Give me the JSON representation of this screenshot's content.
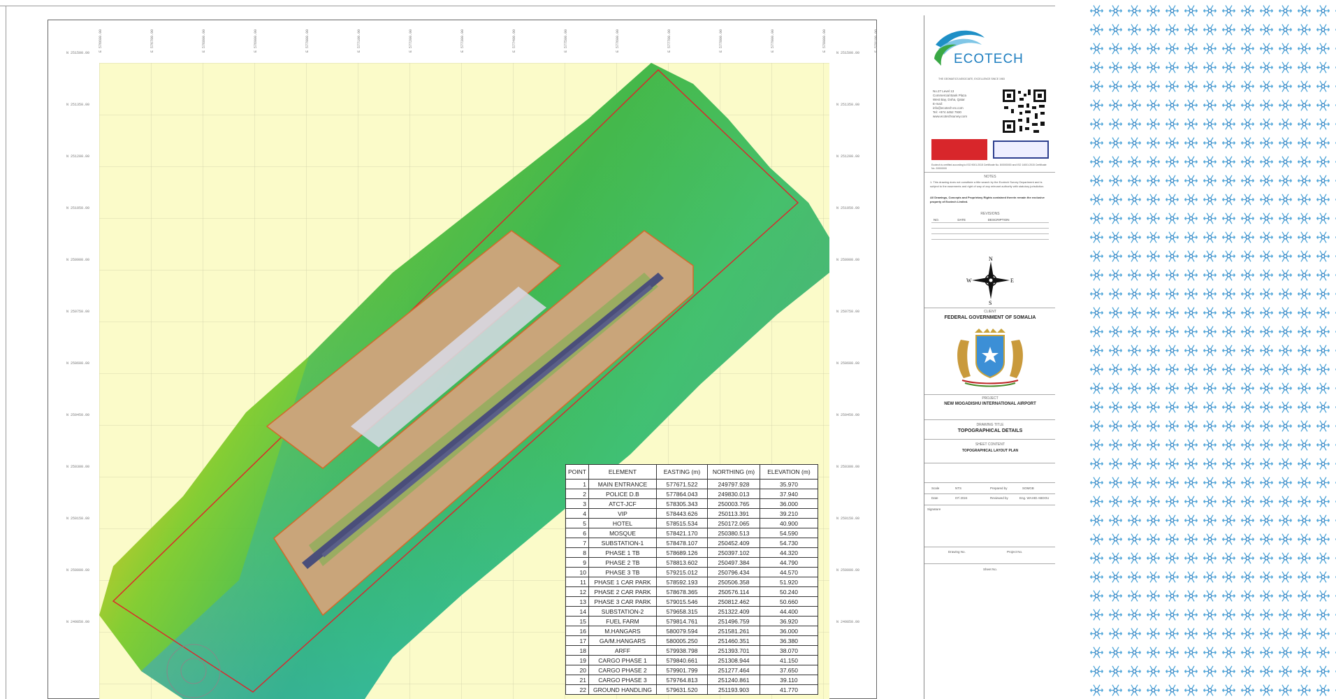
{
  "grid": {
    "eastings": [
      "E 576600.00",
      "E 576700.00",
      "E 576800.00",
      "E 576900.00",
      "E 577000.00",
      "E 577100.00",
      "E 577200.00",
      "E 577300.00",
      "E 577400.00",
      "E 577500.00",
      "E 577600.00",
      "E 577700.00",
      "E 577800.00",
      "E 577900.00",
      "E 578000.00",
      "E 578100.00"
    ],
    "northings_left": [
      "N 251500.00",
      "N 251350.00",
      "N 251200.00",
      "N 251050.00",
      "N 250900.00",
      "N 250750.00",
      "N 250600.00",
      "N 250450.00",
      "N 250300.00",
      "N 250150.00",
      "N 250000.00",
      "N 249850.00"
    ],
    "northings_right": [
      "N 251500.00",
      "N 251350.00",
      "N 251200.00",
      "N 251050.00",
      "N 250900.00",
      "N 250750.00",
      "N 250600.00",
      "N 250450.00",
      "N 250300.00",
      "N 250150.00",
      "N 250000.00",
      "N 249850.00"
    ]
  },
  "table": {
    "headers": [
      "POINT",
      "ELEMENT",
      "EASTING (m)",
      "NORTHING (m)",
      "ELEVATION (m)"
    ],
    "rows": [
      [
        "1",
        "MAIN ENTRANCE",
        "577671.522",
        "249797.928",
        "35.970"
      ],
      [
        "2",
        "POLICE D.B",
        "577864.043",
        "249830.013",
        "37.940"
      ],
      [
        "3",
        "ATCT-JCF",
        "578305.343",
        "250003.765",
        "36.000"
      ],
      [
        "4",
        "VIP",
        "578443.626",
        "250113.391",
        "39.210"
      ],
      [
        "5",
        "HOTEL",
        "578515.534",
        "250172.065",
        "40.900"
      ],
      [
        "6",
        "MOSQUE",
        "578421.170",
        "250380.513",
        "54.590"
      ],
      [
        "7",
        "SUBSTATION-1",
        "578478.107",
        "250452.409",
        "54.730"
      ],
      [
        "8",
        "PHASE 1 TB",
        "578689.126",
        "250397.102",
        "44.320"
      ],
      [
        "9",
        "PHASE 2 TB",
        "578813.602",
        "250497.384",
        "44.790"
      ],
      [
        "10",
        "PHASE 3 TB",
        "579215.012",
        "250796.434",
        "44.570"
      ],
      [
        "11",
        "PHASE 1 CAR PARK",
        "578592.193",
        "250506.358",
        "51.920"
      ],
      [
        "12",
        "PHASE 2 CAR PARK",
        "578678.365",
        "250576.114",
        "50.240"
      ],
      [
        "13",
        "PHASE 3 CAR PARK",
        "579015.546",
        "250812.462",
        "50.660"
      ],
      [
        "14",
        "SUBSTATION-2",
        "579658.315",
        "251322.409",
        "44.400"
      ],
      [
        "15",
        "FUEL FARM",
        "579814.761",
        "251496.759",
        "36.920"
      ],
      [
        "16",
        "M.HANGARS",
        "580079.594",
        "251581.261",
        "36.000"
      ],
      [
        "17",
        "GA/M.HANGARS",
        "580005.250",
        "251460.351",
        "36.380"
      ],
      [
        "18",
        "ARFF",
        "579938.798",
        "251393.701",
        "38.070"
      ],
      [
        "19",
        "CARGO PHASE 1",
        "579840.661",
        "251308.944",
        "41.150"
      ],
      [
        "20",
        "CARGO PHASE 2",
        "579901.799",
        "251277.464",
        "37.650"
      ],
      [
        "21",
        "CARGO PHASE 3",
        "579764.813",
        "251240.861",
        "39.110"
      ],
      [
        "22",
        "GROUND HANDLING",
        "579631.520",
        "251193.903",
        "41.770"
      ]
    ]
  },
  "title_block": {
    "company": "ECOTECH",
    "tagline": "THE GEOMATICS ASSOCIATE, EXCELLENCE SINCE 1983",
    "address_lines": [
      "No.27 Level 13",
      "Commercial Bank Plaza",
      "West Bay, Doha, Qatar",
      "E-mail:",
      "info@ecotech-ex.com",
      "Tel: +974 4452 7930",
      "www.ecotechsurvey.com"
    ],
    "cert_text": "Ecotech is certified according to ISO 9001:2015 Certificate No. 8/0000000 and ISO 14001:2015 Certificate No. 20000000",
    "notes_title": "NOTES",
    "notes_1": "1. This drawing does not constitute a title search by the Ecotech Survey Department and is subject to the easements and right of way of any relevant authority with statutory jurisdiction.",
    "notes_2": "All Drawings, Concepts and Proprietary Rights contained therein remain the exclusive property of Ecotech Limited.",
    "revisions_title": "REVISIONS",
    "rev_headers": [
      "NO.",
      "DATE",
      "DESCRIPTION"
    ],
    "compass": {
      "n": "N",
      "s": "S",
      "e": "E",
      "w": "W"
    },
    "client_label": "CLIENT",
    "client": "FEDERAL GOVERNMENT OF SOMALIA",
    "project_label": "PROJECT",
    "project": "NEW MOGADISHU INTERNATIONAL AIRPORT",
    "drawing_title_label": "DRAWING TITLE",
    "drawing_title": "TOPOGRAPHICAL DETAILS",
    "sheet_content_label": "SHEET CONTENT",
    "sheet_content": "TOPOGRAPHICAL LAYOUT PLAN",
    "scale_label": "Scale",
    "scale": "NTS",
    "prepared_label": "Prepared by",
    "prepared": "SOMGB",
    "date_label": "Date",
    "date": "07/ 2024",
    "reviewed_label": "Reviewed by",
    "reviewed": "Eng. WAHID ABDOU",
    "signature_label": "Signature",
    "drawing_no_label": "Drawing No.",
    "project_no_label": "Project No.",
    "sheet_no_label": "Sheet No."
  },
  "colors": {
    "map_background": "#fbfbc9",
    "boundary": "#e0222a",
    "airport_pad": "#c9a57a",
    "runway": "#4a4e7a",
    "pattern_blue": "#4aa3d8"
  }
}
